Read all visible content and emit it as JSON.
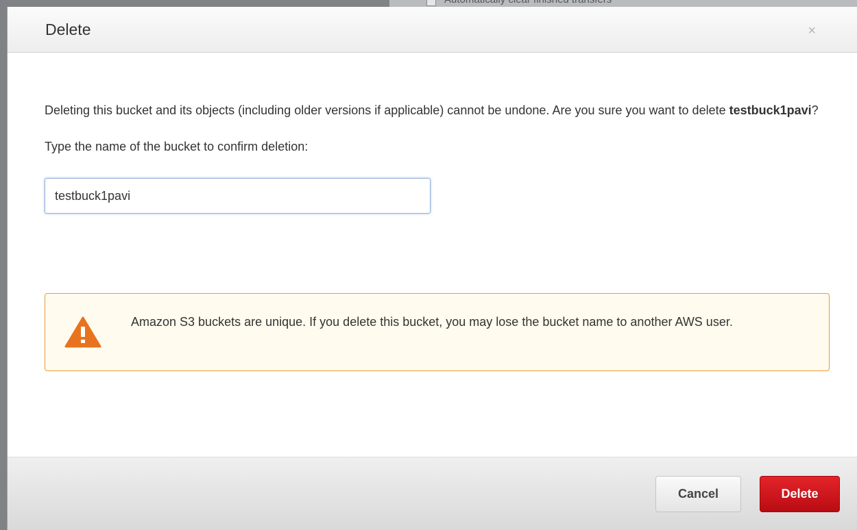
{
  "backdrop": {
    "checkbox_label": "Automatically clear finished transfers"
  },
  "dialog": {
    "title": "Delete",
    "close_glyph": "×",
    "message": {
      "part1": "Deleting this bucket and its objects (including older versions if applicable) cannot be undone. Are you sure you want to delete ",
      "bucket_name": "testbuck1pavi",
      "part2": "?"
    },
    "confirm_label": "Type the name of the bucket to confirm deletion:",
    "confirm_input_value": "testbuck1pavi",
    "warning": {
      "icon": "warning-triangle-icon",
      "text": "Amazon S3 buckets are unique. If you delete this bucket, you may lose the bucket name to another AWS user."
    },
    "buttons": {
      "cancel": "Cancel",
      "delete": "Delete"
    }
  },
  "colors": {
    "delete_button": "#c8141a",
    "warning_border": "#eb9a3a",
    "warning_bg": "#fffbee",
    "warning_icon": "#e8731e"
  }
}
